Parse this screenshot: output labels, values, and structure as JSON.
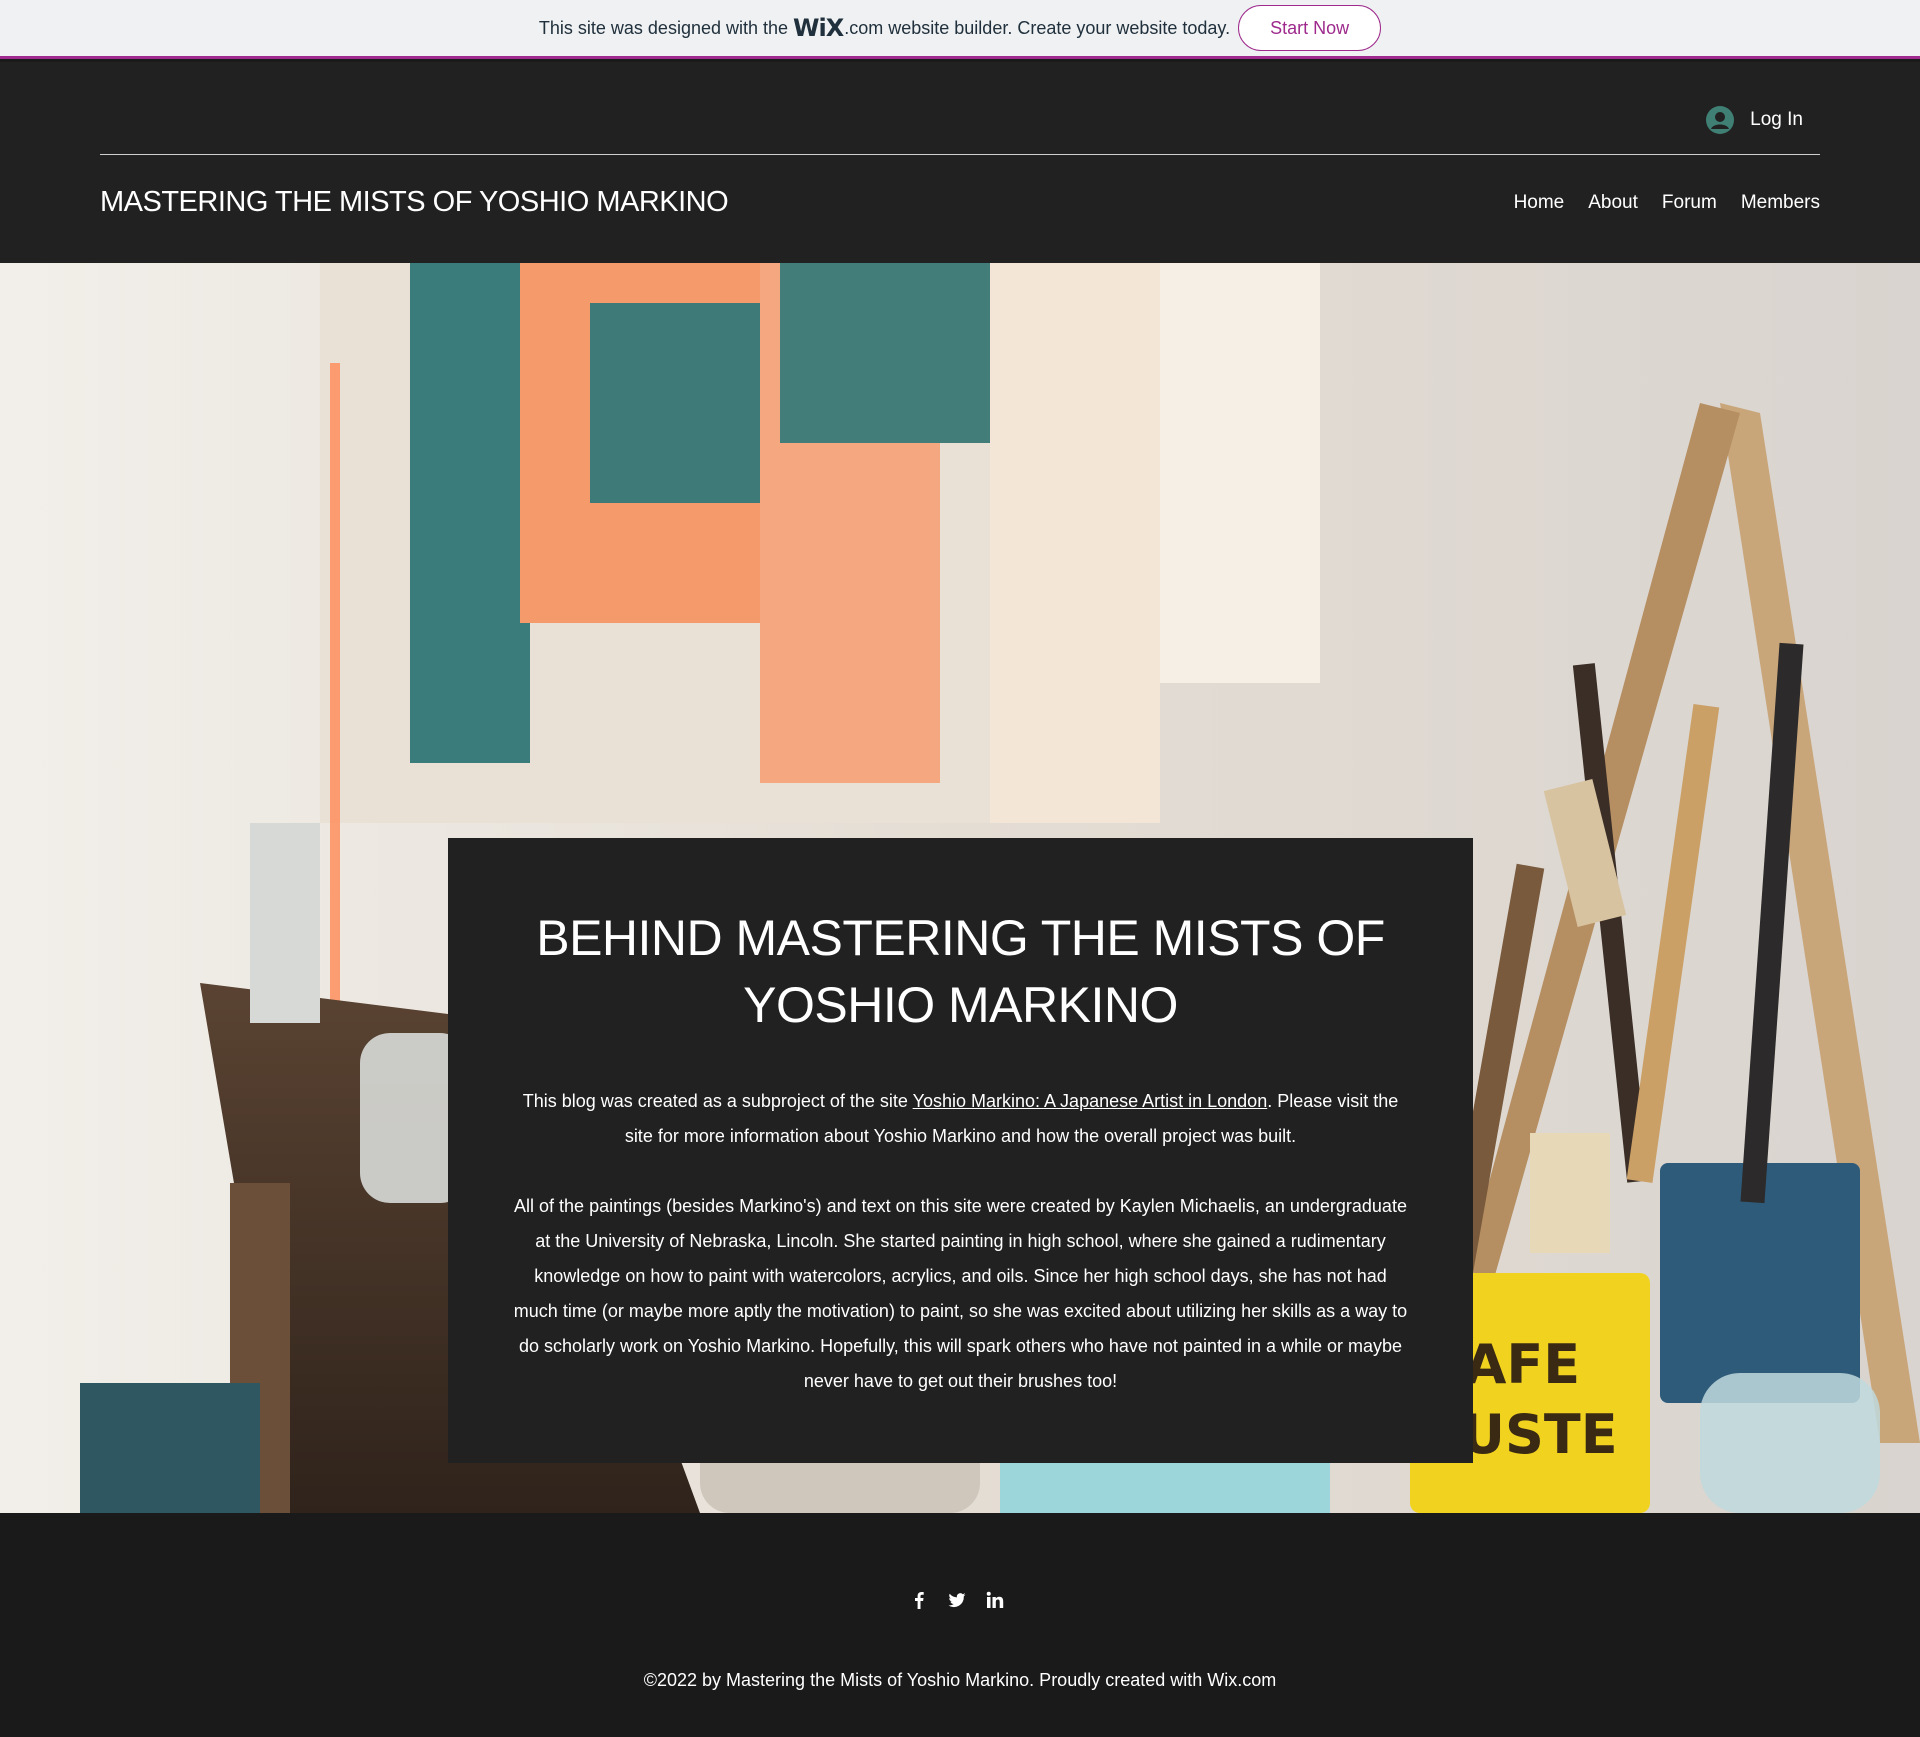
{
  "banner": {
    "text_before": "This site was designed with the",
    "logo": "WiX",
    "dotcom": ".com",
    "text_after": "website builder. Create your website today.",
    "cta": "Start Now"
  },
  "header": {
    "login_label": "Log In",
    "site_title": "MASTERING THE MISTS OF YOSHIO MARKINO",
    "nav": [
      "Home",
      "About",
      "Forum",
      "Members"
    ]
  },
  "panel": {
    "title": "BEHIND MASTERING THE MISTS OF YOSHIO MARKINO",
    "p1_before": "This blog was created as a subproject of the site ",
    "p1_link": "Yoshio Markino: A Japanese Artist in London",
    "p1_after": ". Please visit the site for more information about Yoshio Markino and how the overall project was built.",
    "p2": "All of the paintings (besides Markino's) and text on this site were created by Kaylen Michaelis, an undergraduate at the University of Nebraska, Lincoln. She started painting in high school, where she gained a rudimentary knowledge on how to paint with watercolors, acrylics, and oils. Since her high school days, she has not had much time (or maybe more aptly the motivation) to paint, so she was excited about utilizing her skills as a way to do scholarly work on Yoshio Markino. Hopefully, this will spark others who have not painted in a while or maybe never have to get out their brushes too!"
  },
  "footer": {
    "social_icons": [
      "facebook-icon",
      "twitter-icon",
      "linkedin-icon"
    ],
    "copyright": "©2022 by Mastering the Mists of Yoshio Markino. Proudly created with Wix.com"
  },
  "colors": {
    "wix_purple": "#9d2a8c",
    "header_bg": "#212121",
    "footer_bg": "#1a1a1a",
    "avatar_teal": "#3f7f74"
  }
}
